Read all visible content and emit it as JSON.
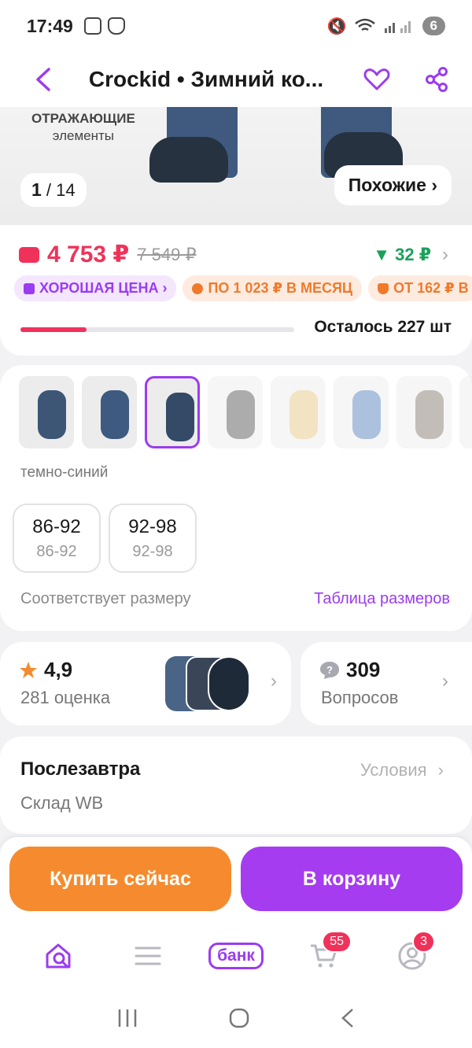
{
  "status_bar": {
    "time": "17:49",
    "battery": "6"
  },
  "header": {
    "title": "Crockid • Зимний ко..."
  },
  "hero": {
    "caption_line1": "ОТРАЖАЮЩИЕ",
    "caption_line2": "элементы",
    "counter_current": "1",
    "counter_total": "/ 14",
    "similar_label": "Похожие ›"
  },
  "pricing": {
    "price": "4 753 ₽",
    "old_price": "7 549 ₽",
    "cashback": "▼ 32 ₽",
    "badges": [
      {
        "label": "ХОРОШАЯ ЦЕНА ›"
      },
      {
        "label": "ПО 1 023 ₽ В МЕСЯЦ"
      },
      {
        "label": "ОТ 162 ₽ В"
      }
    ],
    "stock_progress": 0.24,
    "stock_label": "Осталось 227 шт"
  },
  "variants": {
    "color_label": "темно-синий",
    "thumbnails": [
      {
        "color": "#3d5676"
      },
      {
        "color": "#3e5a80"
      },
      {
        "color": "#344a66"
      },
      {
        "color": "#4a4a4a"
      },
      {
        "color": "#e3c27a"
      },
      {
        "color": "#4978b8"
      },
      {
        "color": "#7b6f62"
      },
      {
        "color": "#9a9a9a"
      }
    ],
    "sizes": [
      {
        "main": "86-92",
        "sub": "86-92"
      },
      {
        "main": "92-98",
        "sub": "92-98"
      }
    ],
    "fit_text": "Соответствует размеру",
    "size_table_link": "Таблица размеров"
  },
  "rating": {
    "score": "4,9",
    "count_label": "281 оценка"
  },
  "questions": {
    "count": "309",
    "label": "Вопросов"
  },
  "delivery": {
    "title": "Послезавтра",
    "conditions_link": "Условия",
    "warehouse": "Склад WB"
  },
  "actions": {
    "buy_now": "Купить сейчас",
    "add_to_cart": "В корзину"
  },
  "bottom_nav": {
    "bank_label": "банк",
    "cart_badge": "55",
    "profile_badge": "3"
  },
  "colors": {
    "accent": "#9b3cf0",
    "price": "#f0325a",
    "buy_button": "#f58b2e",
    "cart_button": "#a53cf0",
    "cashback": "#1aa15a"
  }
}
